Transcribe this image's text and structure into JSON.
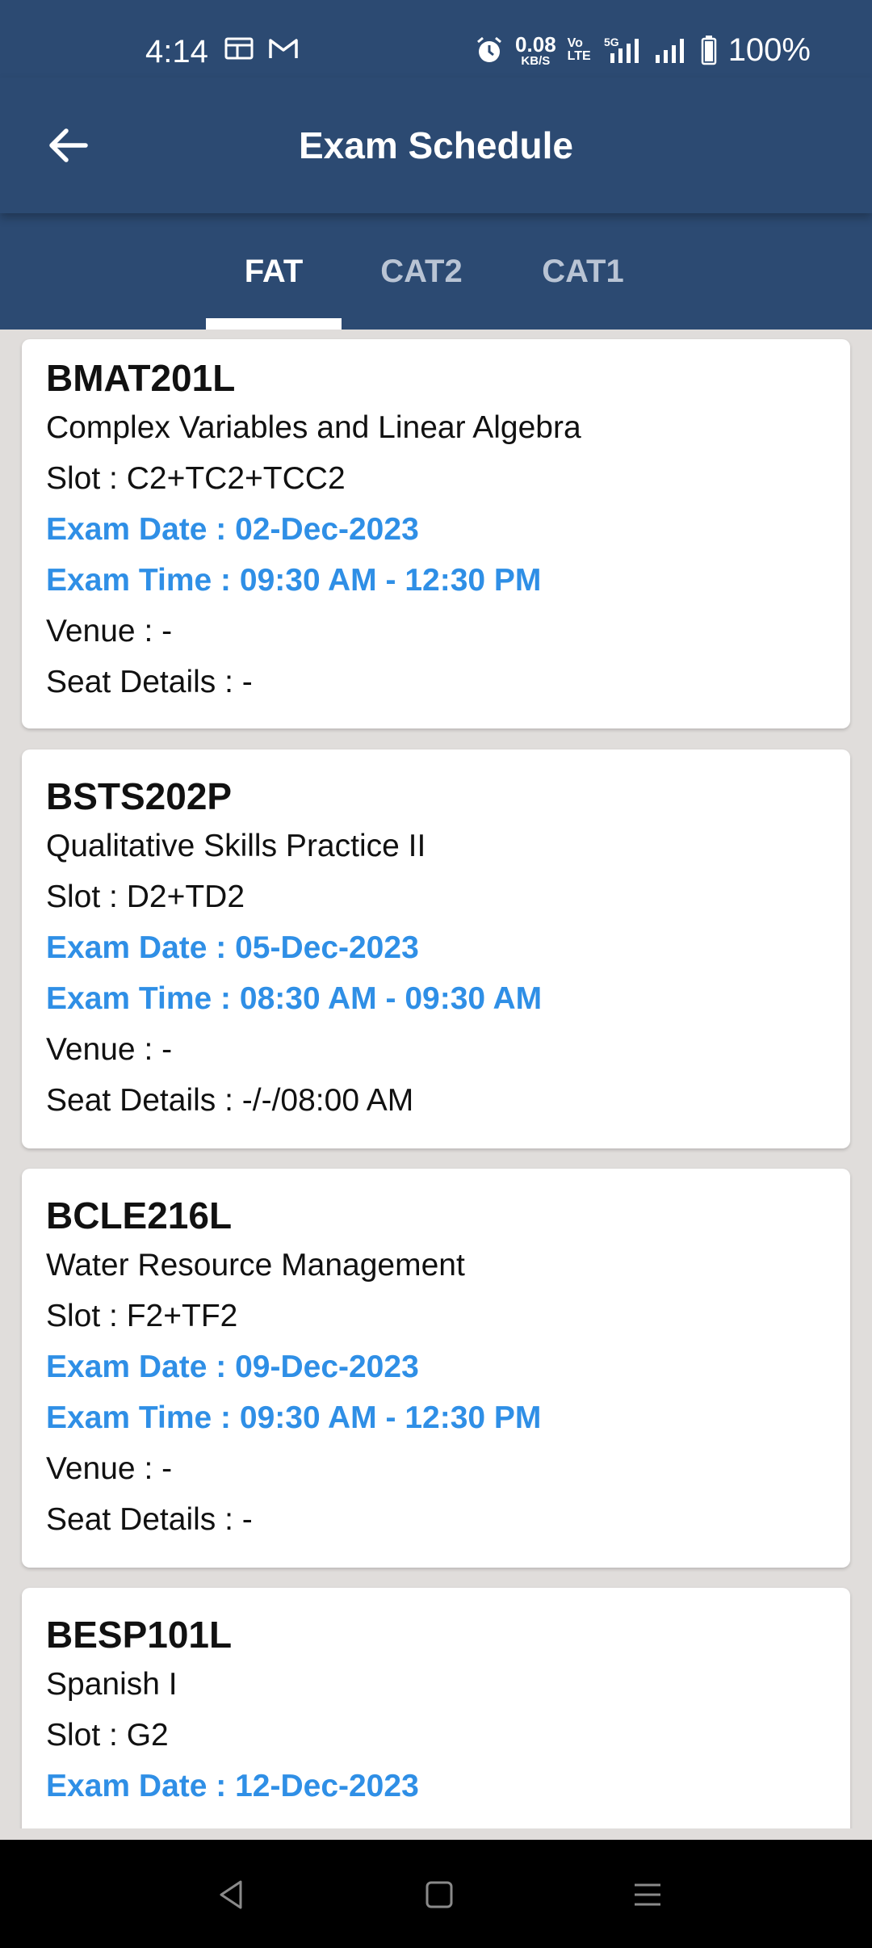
{
  "status_bar": {
    "time": "4:14",
    "speed_value": "0.08",
    "speed_unit": "KB/S",
    "volte_top": "Vo",
    "volte_bottom": "LTE",
    "network": "5G",
    "battery": "100%"
  },
  "header": {
    "title": "Exam Schedule"
  },
  "tabs": [
    {
      "label": "FAT",
      "active": true
    },
    {
      "label": "CAT2",
      "active": false
    },
    {
      "label": "CAT1",
      "active": false
    }
  ],
  "exams": [
    {
      "code": "BMAT201L",
      "title": "Complex Variables and Linear Algebra",
      "slot": "Slot : C2+TC2+TCC2",
      "date": "Exam Date : 02-Dec-2023",
      "time": "Exam Time : 09:30 AM - 12:30 PM",
      "venue": "Venue : -",
      "seat": "Seat Details : -"
    },
    {
      "code": "BSTS202P",
      "title": "Qualitative Skills Practice II",
      "slot": "Slot : D2+TD2",
      "date": "Exam Date : 05-Dec-2023",
      "time": "Exam Time : 08:30 AM - 09:30 AM",
      "venue": "Venue : -",
      "seat": "Seat Details : -/-/08:00 AM"
    },
    {
      "code": "BCLE216L",
      "title": "Water Resource Management",
      "slot": "Slot : F2+TF2",
      "date": "Exam Date : 09-Dec-2023",
      "time": "Exam Time : 09:30 AM - 12:30 PM",
      "venue": "Venue : -",
      "seat": "Seat Details : -"
    },
    {
      "code": "BESP101L",
      "title": "Spanish I",
      "slot": "Slot : G2",
      "date": "Exam Date : 12-Dec-2023"
    }
  ],
  "colors": {
    "primary": "#2c4a72",
    "accent_text": "#2f8fe6",
    "background": "#e0dddb"
  }
}
